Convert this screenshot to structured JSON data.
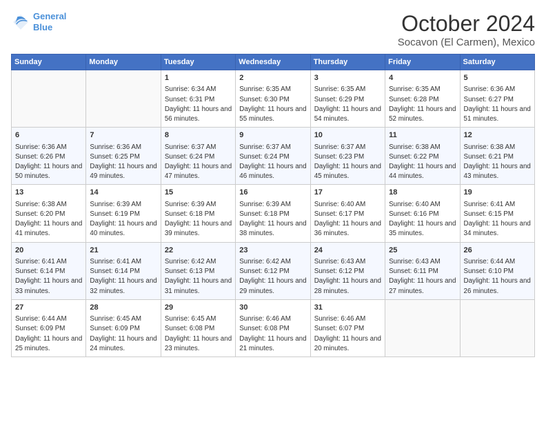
{
  "header": {
    "logo_line1": "General",
    "logo_line2": "Blue",
    "month": "October 2024",
    "location": "Socavon (El Carmen), Mexico"
  },
  "weekdays": [
    "Sunday",
    "Monday",
    "Tuesday",
    "Wednesday",
    "Thursday",
    "Friday",
    "Saturday"
  ],
  "weeks": [
    [
      {
        "day": "",
        "info": ""
      },
      {
        "day": "",
        "info": ""
      },
      {
        "day": "1",
        "info": "Sunrise: 6:34 AM\nSunset: 6:31 PM\nDaylight: 11 hours and 56 minutes."
      },
      {
        "day": "2",
        "info": "Sunrise: 6:35 AM\nSunset: 6:30 PM\nDaylight: 11 hours and 55 minutes."
      },
      {
        "day": "3",
        "info": "Sunrise: 6:35 AM\nSunset: 6:29 PM\nDaylight: 11 hours and 54 minutes."
      },
      {
        "day": "4",
        "info": "Sunrise: 6:35 AM\nSunset: 6:28 PM\nDaylight: 11 hours and 52 minutes."
      },
      {
        "day": "5",
        "info": "Sunrise: 6:36 AM\nSunset: 6:27 PM\nDaylight: 11 hours and 51 minutes."
      }
    ],
    [
      {
        "day": "6",
        "info": "Sunrise: 6:36 AM\nSunset: 6:26 PM\nDaylight: 11 hours and 50 minutes."
      },
      {
        "day": "7",
        "info": "Sunrise: 6:36 AM\nSunset: 6:25 PM\nDaylight: 11 hours and 49 minutes."
      },
      {
        "day": "8",
        "info": "Sunrise: 6:37 AM\nSunset: 6:24 PM\nDaylight: 11 hours and 47 minutes."
      },
      {
        "day": "9",
        "info": "Sunrise: 6:37 AM\nSunset: 6:24 PM\nDaylight: 11 hours and 46 minutes."
      },
      {
        "day": "10",
        "info": "Sunrise: 6:37 AM\nSunset: 6:23 PM\nDaylight: 11 hours and 45 minutes."
      },
      {
        "day": "11",
        "info": "Sunrise: 6:38 AM\nSunset: 6:22 PM\nDaylight: 11 hours and 44 minutes."
      },
      {
        "day": "12",
        "info": "Sunrise: 6:38 AM\nSunset: 6:21 PM\nDaylight: 11 hours and 43 minutes."
      }
    ],
    [
      {
        "day": "13",
        "info": "Sunrise: 6:38 AM\nSunset: 6:20 PM\nDaylight: 11 hours and 41 minutes."
      },
      {
        "day": "14",
        "info": "Sunrise: 6:39 AM\nSunset: 6:19 PM\nDaylight: 11 hours and 40 minutes."
      },
      {
        "day": "15",
        "info": "Sunrise: 6:39 AM\nSunset: 6:18 PM\nDaylight: 11 hours and 39 minutes."
      },
      {
        "day": "16",
        "info": "Sunrise: 6:39 AM\nSunset: 6:18 PM\nDaylight: 11 hours and 38 minutes."
      },
      {
        "day": "17",
        "info": "Sunrise: 6:40 AM\nSunset: 6:17 PM\nDaylight: 11 hours and 36 minutes."
      },
      {
        "day": "18",
        "info": "Sunrise: 6:40 AM\nSunset: 6:16 PM\nDaylight: 11 hours and 35 minutes."
      },
      {
        "day": "19",
        "info": "Sunrise: 6:41 AM\nSunset: 6:15 PM\nDaylight: 11 hours and 34 minutes."
      }
    ],
    [
      {
        "day": "20",
        "info": "Sunrise: 6:41 AM\nSunset: 6:14 PM\nDaylight: 11 hours and 33 minutes."
      },
      {
        "day": "21",
        "info": "Sunrise: 6:41 AM\nSunset: 6:14 PM\nDaylight: 11 hours and 32 minutes."
      },
      {
        "day": "22",
        "info": "Sunrise: 6:42 AM\nSunset: 6:13 PM\nDaylight: 11 hours and 31 minutes."
      },
      {
        "day": "23",
        "info": "Sunrise: 6:42 AM\nSunset: 6:12 PM\nDaylight: 11 hours and 29 minutes."
      },
      {
        "day": "24",
        "info": "Sunrise: 6:43 AM\nSunset: 6:12 PM\nDaylight: 11 hours and 28 minutes."
      },
      {
        "day": "25",
        "info": "Sunrise: 6:43 AM\nSunset: 6:11 PM\nDaylight: 11 hours and 27 minutes."
      },
      {
        "day": "26",
        "info": "Sunrise: 6:44 AM\nSunset: 6:10 PM\nDaylight: 11 hours and 26 minutes."
      }
    ],
    [
      {
        "day": "27",
        "info": "Sunrise: 6:44 AM\nSunset: 6:09 PM\nDaylight: 11 hours and 25 minutes."
      },
      {
        "day": "28",
        "info": "Sunrise: 6:45 AM\nSunset: 6:09 PM\nDaylight: 11 hours and 24 minutes."
      },
      {
        "day": "29",
        "info": "Sunrise: 6:45 AM\nSunset: 6:08 PM\nDaylight: 11 hours and 23 minutes."
      },
      {
        "day": "30",
        "info": "Sunrise: 6:46 AM\nSunset: 6:08 PM\nDaylight: 11 hours and 21 minutes."
      },
      {
        "day": "31",
        "info": "Sunrise: 6:46 AM\nSunset: 6:07 PM\nDaylight: 11 hours and 20 minutes."
      },
      {
        "day": "",
        "info": ""
      },
      {
        "day": "",
        "info": ""
      }
    ]
  ]
}
